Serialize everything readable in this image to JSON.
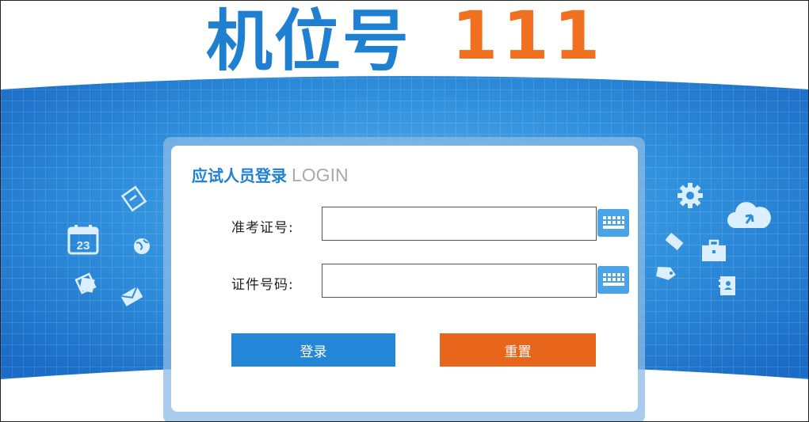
{
  "header": {
    "title_text": "机位号",
    "seat_number": "111"
  },
  "login_panel": {
    "title_cn": "应试人员登录",
    "title_en": "LOGIN",
    "fields": [
      {
        "label": "准考证号:",
        "value": "",
        "placeholder": ""
      },
      {
        "label": "证件号码:",
        "value": "",
        "placeholder": ""
      }
    ],
    "buttons": {
      "login": "登录",
      "reset": "重置"
    }
  },
  "decoration": {
    "calendar_day": "23"
  },
  "colors": {
    "brand_blue": "#1f7fd0",
    "accent_orange": "#f07020",
    "login_button": "#2486d6",
    "reset_button": "#e8651c",
    "banner_blue": "#2f8fdc"
  },
  "icons": {
    "keyboard_button": "keyboard-icon",
    "banner_left": [
      "notepad-icon",
      "calendar-icon",
      "globe-icon",
      "photos-icon",
      "envelope-icon"
    ],
    "banner_right": [
      "gear-icon",
      "cloud-upload-icon",
      "ruler-icon",
      "briefcase-icon",
      "tag-icon",
      "contacts-icon"
    ]
  }
}
